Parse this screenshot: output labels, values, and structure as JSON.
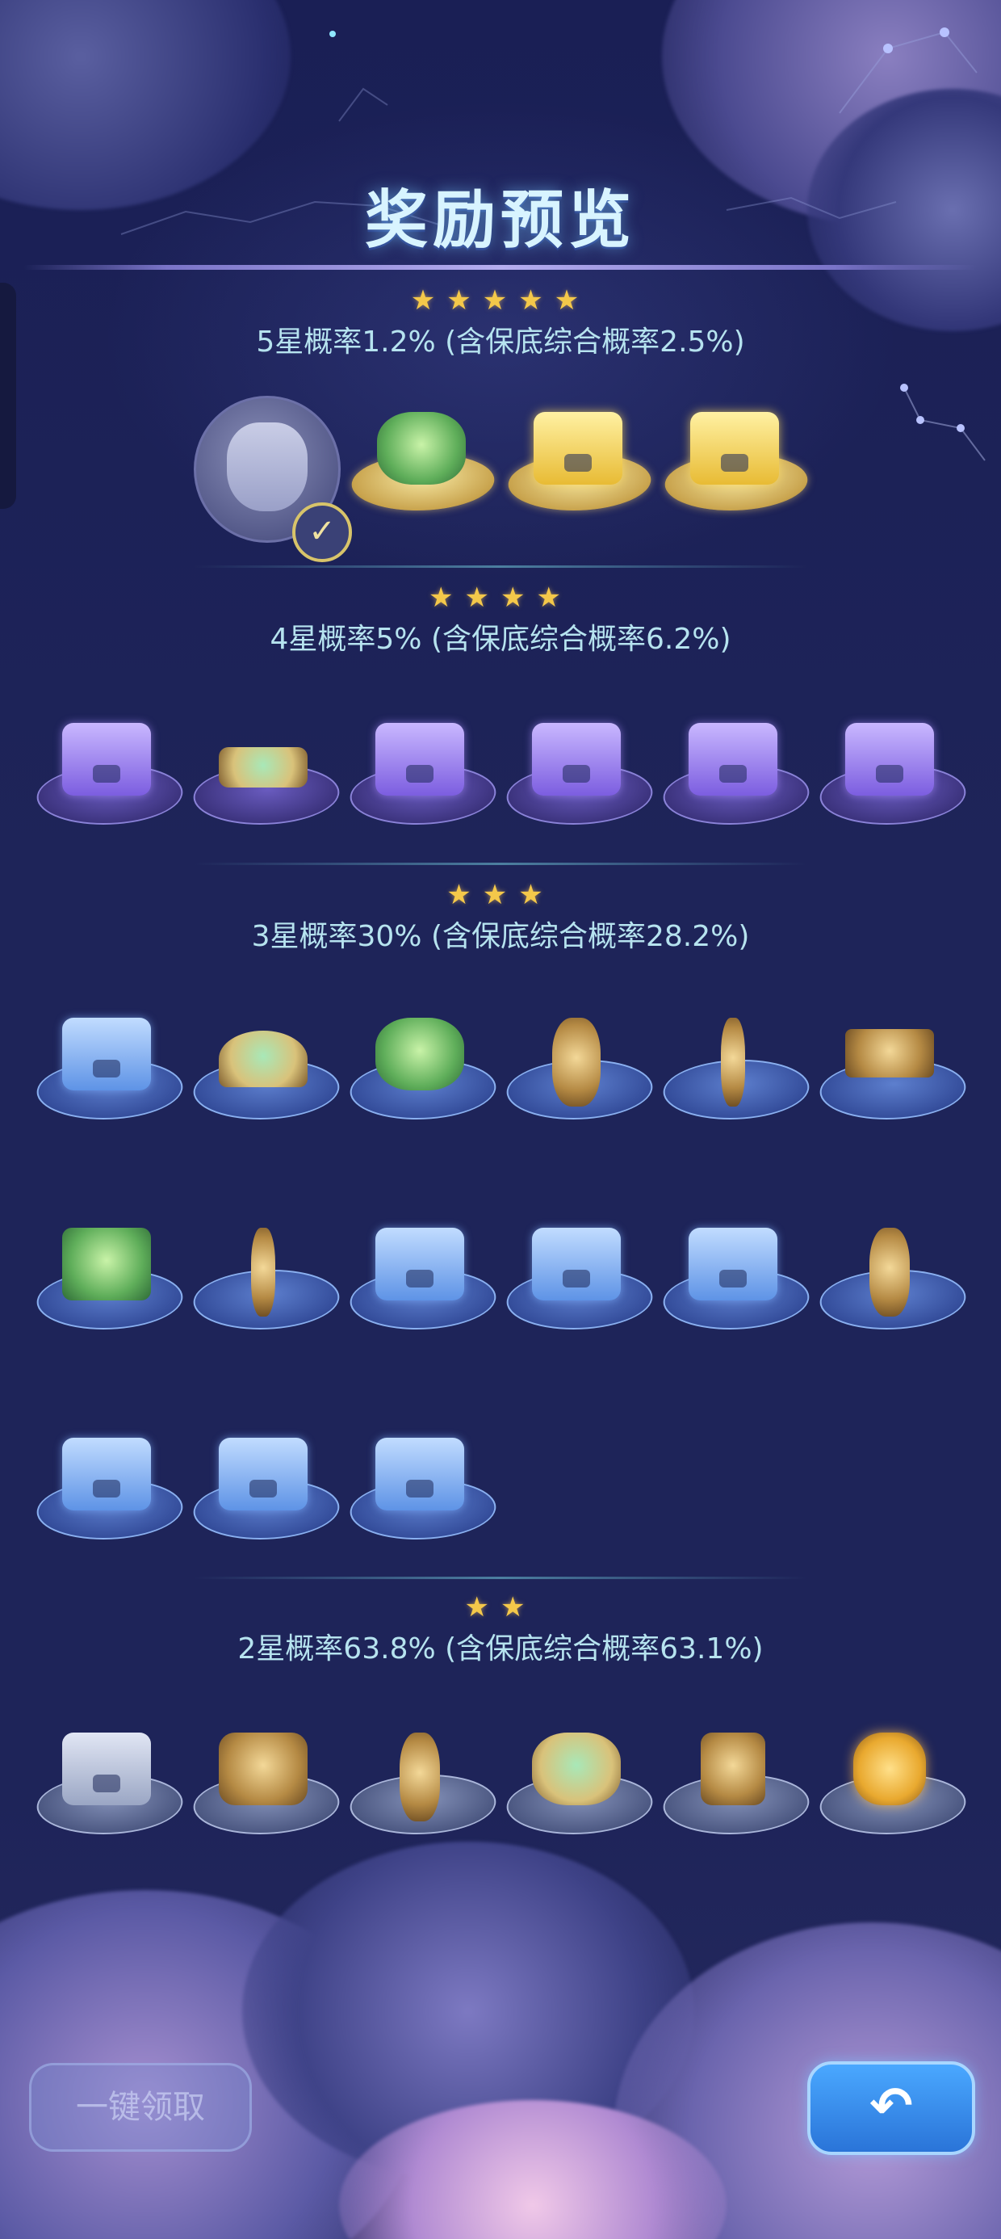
{
  "title": "奖励预览",
  "tiers": [
    {
      "stars": "★★★★★",
      "rate": "5星概率1.2% (含保底综合概率2.5%)"
    },
    {
      "stars": "★★★★",
      "rate": "4星概率5% (含保底综合概率6.2%)"
    },
    {
      "stars": "★★★",
      "rate": "3星概率30% (含保底综合概率28.2%)"
    },
    {
      "stars": "★★",
      "rate": "2星概率63.8% (含保底综合概率63.1%)"
    }
  ],
  "buttons": {
    "claim_all": "一键领取",
    "back_icon": "return-arrow-icon"
  },
  "colors": {
    "background": "#1e2459",
    "title": "#d8f4ff",
    "rate_text": "#b6e3ef",
    "star": "#f4c84a",
    "back_button": "#3a8ef0"
  }
}
